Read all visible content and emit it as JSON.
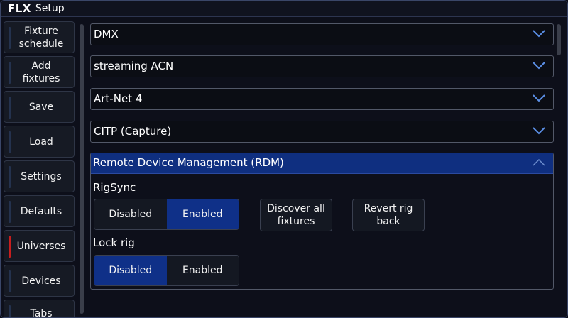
{
  "window": {
    "logo": "FLX",
    "title": "Setup"
  },
  "sidebar": {
    "items": [
      {
        "label": "Fixture\nschedule",
        "active": false
      },
      {
        "label": "Add\nfixtures",
        "active": false
      },
      {
        "label": "Save",
        "active": false
      },
      {
        "label": "Load",
        "active": false
      },
      {
        "label": "Settings",
        "active": false
      },
      {
        "label": "Defaults",
        "active": false
      },
      {
        "label": "Universes",
        "active": true
      },
      {
        "label": "Devices",
        "active": false
      },
      {
        "label": "Tabs",
        "active": false
      }
    ]
  },
  "sections": [
    {
      "label": "DMX",
      "expanded": false
    },
    {
      "label": "streaming ACN",
      "expanded": false
    },
    {
      "label": "Art-Net 4",
      "expanded": false
    },
    {
      "label": "CITP (Capture)",
      "expanded": false
    }
  ],
  "rdm": {
    "header": "Remote Device Management (RDM)",
    "expanded": true,
    "rigsync": {
      "label": "RigSync",
      "options": [
        "Disabled",
        "Enabled"
      ],
      "selected": "Enabled"
    },
    "discover_button": "Discover all\nfixtures",
    "revert_button": "Revert rig\nback",
    "lock_rig": {
      "label": "Lock rig",
      "options": [
        "Disabled",
        "Enabled"
      ],
      "selected": "Disabled"
    }
  },
  "colors": {
    "accent": "#0f3088",
    "header_blue": "#0f2f80",
    "active_marker": "#c81e1e",
    "chevron": "#5b8fe6"
  },
  "icons": {
    "section_collapsed": "chevron-down-icon",
    "section_expanded": "chevron-up-icon"
  }
}
